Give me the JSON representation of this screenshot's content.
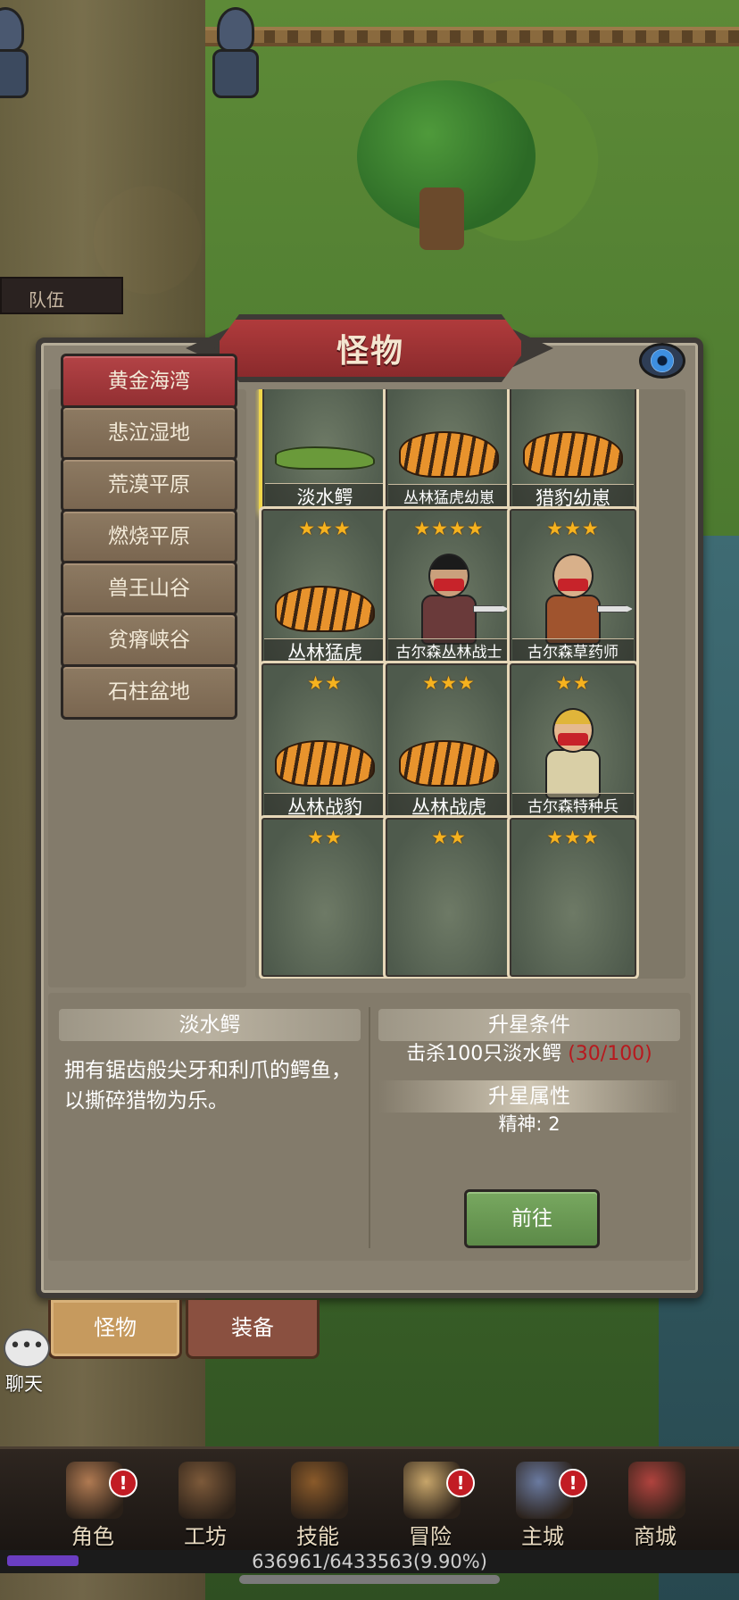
{
  "background": {
    "team_tab": "队伍"
  },
  "panel": {
    "title": "怪物"
  },
  "regions": [
    {
      "label": "黄金海湾",
      "active": true
    },
    {
      "label": "悲泣湿地",
      "active": false
    },
    {
      "label": "荒漠平原",
      "active": false
    },
    {
      "label": "燃烧平原",
      "active": false
    },
    {
      "label": "兽王山谷",
      "active": false
    },
    {
      "label": "贫瘠峡谷",
      "active": false
    },
    {
      "label": "石柱盆地",
      "active": false
    }
  ],
  "monsters": [
    {
      "name": "淡水鳄",
      "stars": "★★",
      "sprite": "crocodile",
      "selected": true
    },
    {
      "name": "丛林猛虎幼崽",
      "stars": "★★",
      "sprite": "tiger"
    },
    {
      "name": "猎豹幼崽",
      "stars": "★★",
      "sprite": "tiger"
    },
    {
      "name": "丛林猛虎",
      "stars": "★★★",
      "sprite": "tiger"
    },
    {
      "name": "古尔森丛林战士",
      "stars": "★★★★",
      "sprite": "warrior"
    },
    {
      "name": "古尔森草药师",
      "stars": "★★★",
      "sprite": "herbalist"
    },
    {
      "name": "丛林战豹",
      "stars": "★★",
      "sprite": "tiger"
    },
    {
      "name": "丛林战虎",
      "stars": "★★★",
      "sprite": "tiger"
    },
    {
      "name": "古尔森特种兵",
      "stars": "★★",
      "sprite": "soldier"
    },
    {
      "name": "",
      "stars": "★★",
      "sprite": "none"
    },
    {
      "name": "",
      "stars": "★★",
      "sprite": "none"
    },
    {
      "name": "",
      "stars": "★★★",
      "sprite": "none"
    }
  ],
  "detail": {
    "name": "淡水鳄",
    "description": "拥有锯齿般尖牙和利爪的鳄鱼，以撕碎猎物为乐。",
    "upgrade_condition_title": "升星条件",
    "upgrade_condition_text": "击杀100只淡水鳄",
    "upgrade_condition_progress": "(30/100)",
    "upgrade_attr_title": "升星属性",
    "upgrade_attr_text": "精神: 2",
    "go_button": "前往"
  },
  "sub_tabs": {
    "monster": "怪物",
    "equipment": "装备"
  },
  "chat": {
    "label": "聊天",
    "icon": "•••"
  },
  "bottom_nav": [
    {
      "label": "角色",
      "icon": "character-icon",
      "badge": "!"
    },
    {
      "label": "工坊",
      "icon": "workshop-icon",
      "badge": ""
    },
    {
      "label": "技能",
      "icon": "skill-book-icon",
      "badge": ""
    },
    {
      "label": "冒险",
      "icon": "adventure-map-icon",
      "badge": "!"
    },
    {
      "label": "主城",
      "icon": "castle-icon",
      "badge": "!"
    },
    {
      "label": "商城",
      "icon": "shop-icon",
      "badge": ""
    }
  ],
  "xp": {
    "text": "636961/6433563(9.90%)",
    "fraction": 0.099,
    "color": "#6a3ec2"
  },
  "colors": {
    "active_region": "#b34346",
    "selected_card_border": "#f0d64a",
    "star": "#f6b21e",
    "progress_red": "#b8191e",
    "go_button": "#6a9a54"
  }
}
